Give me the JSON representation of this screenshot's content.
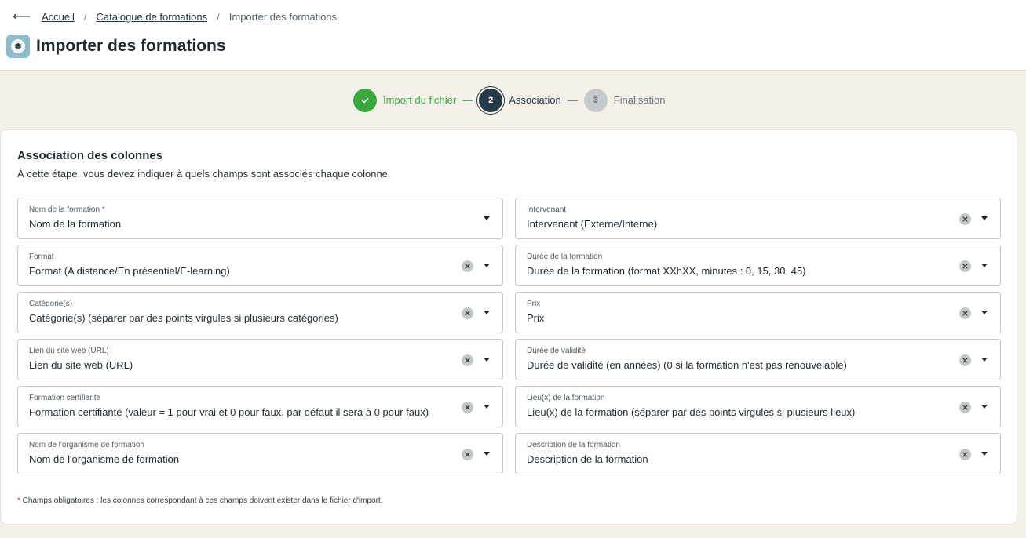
{
  "breadcrumb": {
    "back_icon": "arrow-left-icon",
    "home": "Accueil",
    "catalogue": "Catalogue de formations",
    "current": "Importer des formations",
    "separator": "/"
  },
  "page": {
    "title": "Importer des formations",
    "icon": "graduation-cap-icon",
    "icon_color": "#8fbccb"
  },
  "stepper": {
    "steps": [
      {
        "number": "",
        "label": "Import du fichier",
        "state": "done"
      },
      {
        "number": "2",
        "label": "Association",
        "state": "active"
      },
      {
        "number": "3",
        "label": "Finalisation",
        "state": "todo"
      }
    ],
    "separator": "—",
    "colors": {
      "done": "#3aa83f",
      "active": "#253a47",
      "todo": "#c6cacd"
    }
  },
  "card": {
    "title": "Association des colonnes",
    "subtitle": "À cette étape, vous devez indiquer à quels champs sont associés chaque colonne."
  },
  "fields": [
    {
      "label": "Nom de la formation",
      "required": true,
      "value": "Nom de la formation",
      "clearable": false
    },
    {
      "label": "Intervenant",
      "required": false,
      "value": "Intervenant (Externe/Interne)",
      "clearable": true
    },
    {
      "label": "Format",
      "required": false,
      "value": "Format (A distance/En présentiel/E-learning)",
      "clearable": true
    },
    {
      "label": "Durée de la formation",
      "required": false,
      "value": "Durée de la formation (format XXhXX, minutes : 0, 15, 30, 45)",
      "clearable": true
    },
    {
      "label": "Catégorie(s)",
      "required": false,
      "value": "Catégorie(s) (séparer par des points virgules si plusieurs catégories)",
      "clearable": true
    },
    {
      "label": "Prix",
      "required": false,
      "value": "Prix",
      "clearable": true
    },
    {
      "label": "Lien du site web (URL)",
      "required": false,
      "value": "Lien du site web (URL)",
      "clearable": true
    },
    {
      "label": "Durée de validité",
      "required": false,
      "value": "Durée de validité (en années) (0 si la formation n'est pas renouvelable)",
      "clearable": true
    },
    {
      "label": "Formation certifiante",
      "required": false,
      "value": "Formation certifiante (valeur = 1 pour vrai et 0 pour faux. par défaut il sera à 0 pour faux)",
      "clearable": true
    },
    {
      "label": "Lieu(x) de la formation",
      "required": false,
      "value": "Lieu(x) de la formation (séparer par des points virgules si plusieurs lieux)",
      "clearable": true
    },
    {
      "label": "Nom de l'organisme de formation",
      "required": false,
      "value": "Nom de l'organisme de formation",
      "clearable": true
    },
    {
      "label": "Description de la formation",
      "required": false,
      "value": "Description de la formation",
      "clearable": true
    }
  ],
  "footnote": {
    "asterisk": "*",
    "text": " Champs obligatoires : les colonnes correspondant à ces champs doivent exister dans le fichier d'import."
  }
}
